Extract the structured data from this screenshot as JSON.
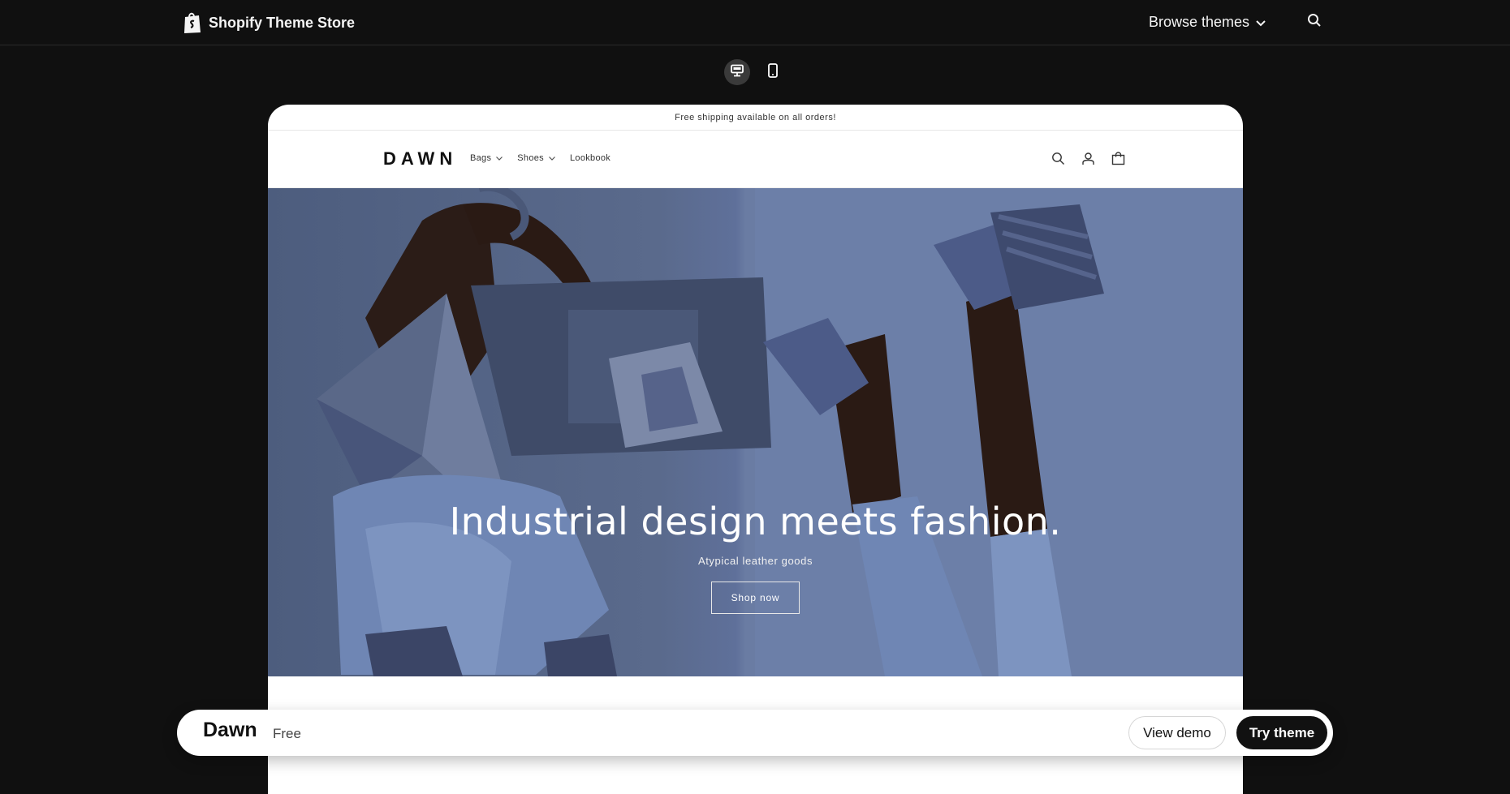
{
  "topnav": {
    "brand_label": "Shopify Theme Store",
    "browse_label": "Browse themes",
    "search_icon": "search-icon"
  },
  "device_toggle": {
    "desktop_icon": "desktop-icon",
    "mobile_icon": "mobile-icon",
    "active": "desktop"
  },
  "preview": {
    "announcement": "Free shipping available on all orders!",
    "logo": "DAWN",
    "menu": [
      {
        "label": "Bags",
        "has_dropdown": true
      },
      {
        "label": "Shoes",
        "has_dropdown": true
      },
      {
        "label": "Lookbook",
        "has_dropdown": false
      }
    ],
    "icons": [
      "search-icon",
      "account-icon",
      "cart-icon"
    ],
    "hero": {
      "title": "Industrial design meets fashion.",
      "subtitle": "Atypical leather goods",
      "button": "Shop now"
    }
  },
  "bottom_bar": {
    "theme_name": "Dawn",
    "price": "Free",
    "view_demo": "View demo",
    "try_theme": "Try theme"
  },
  "colors": {
    "page_bg": "#101010",
    "hero_blue": "#5f709a",
    "button_dark": "#111111"
  }
}
